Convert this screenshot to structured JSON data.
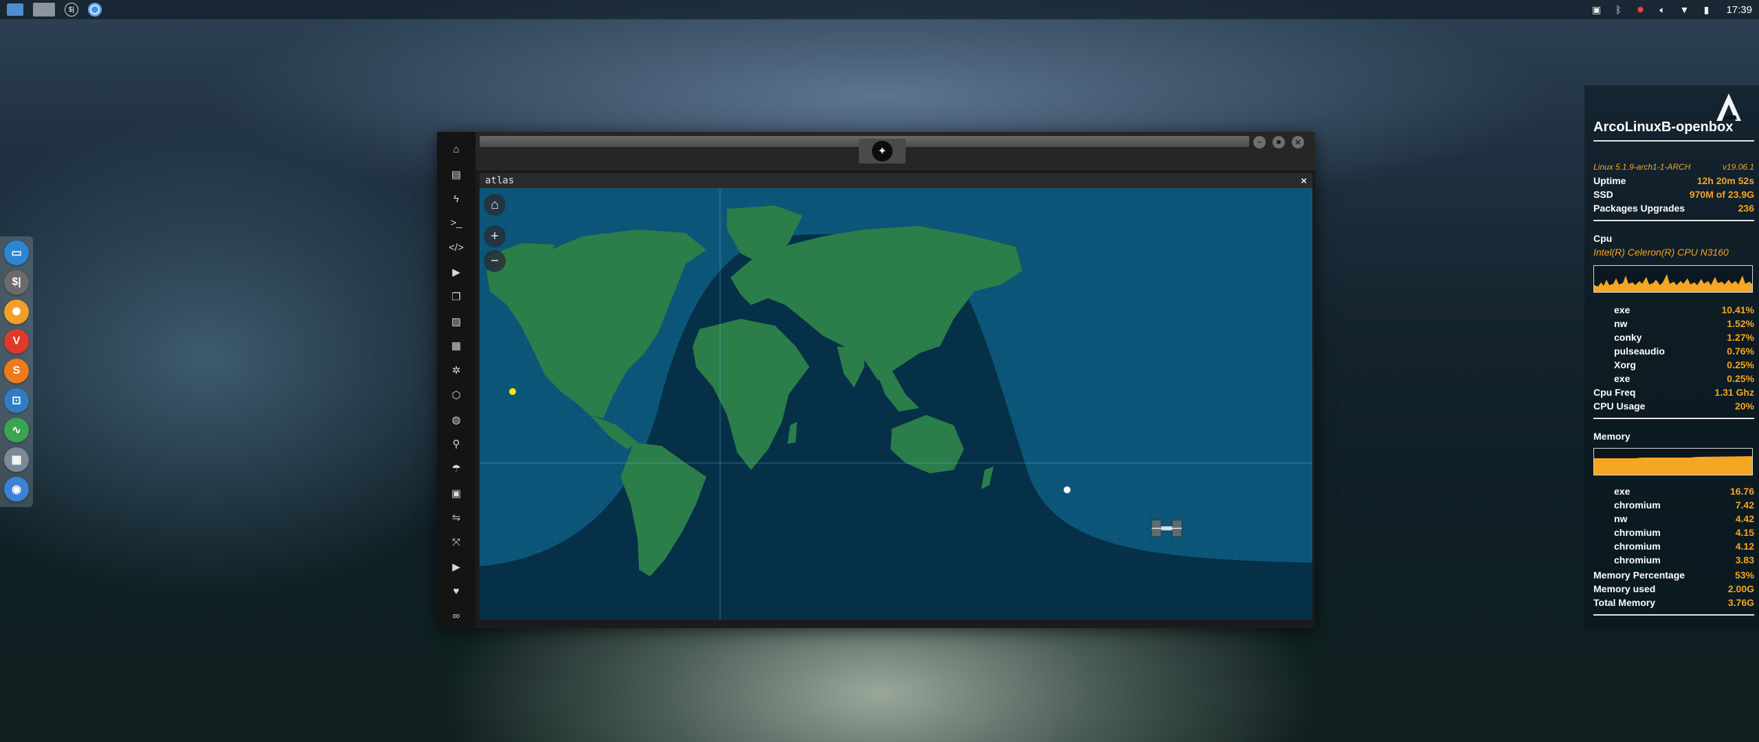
{
  "top_panel": {
    "launchers": [
      {
        "name": "files-icon"
      },
      {
        "name": "workspace-switcher-icon"
      },
      {
        "name": "terminal-icon",
        "glyph": "$|"
      },
      {
        "name": "chromium-icon"
      }
    ],
    "tray": [
      "screenshot-icon",
      "bluetooth-icon",
      "bug-icon",
      "volume-icon",
      "wifi-icon",
      "power-icon"
    ],
    "clock": "17:39"
  },
  "dock": {
    "items": [
      {
        "name": "files",
        "color": "#2d86d1",
        "glyph": "▭"
      },
      {
        "name": "terminal",
        "color": "#6b6b6b",
        "glyph": "$|"
      },
      {
        "name": "settings",
        "color": "#f0a02a",
        "glyph": "✺"
      },
      {
        "name": "vivaldi",
        "color": "#e0392a",
        "glyph": "V"
      },
      {
        "name": "sublime",
        "color": "#ee7a1e",
        "glyph": "S"
      },
      {
        "name": "screenshot",
        "color": "#2f7cc4",
        "glyph": "⊡"
      },
      {
        "name": "system-monitor",
        "color": "#3aa450",
        "glyph": "∿"
      },
      {
        "name": "workspace",
        "color": "#7b8a99",
        "glyph": "▦"
      },
      {
        "name": "chromium",
        "color": "#3d82d6",
        "glyph": "◉"
      }
    ]
  },
  "window": {
    "emblem_glyph": "✦",
    "buttons": {
      "minimize": "–",
      "maximize": "■",
      "close": "✕"
    },
    "sidebar_icons": [
      {
        "name": "home",
        "glyph": "⌂"
      },
      {
        "name": "document",
        "glyph": "▤"
      },
      {
        "name": "bolt",
        "glyph": "ϟ"
      },
      {
        "name": "terminal",
        "glyph": ">_"
      },
      {
        "name": "code",
        "glyph": "</>"
      },
      {
        "name": "play",
        "glyph": "▶"
      },
      {
        "name": "copy",
        "glyph": "❐"
      },
      {
        "name": "image",
        "glyph": "▨"
      },
      {
        "name": "news",
        "glyph": "▦"
      },
      {
        "name": "atom",
        "glyph": "✲"
      },
      {
        "name": "hexagon",
        "glyph": "⬡"
      },
      {
        "name": "globe",
        "glyph": "◍"
      },
      {
        "name": "search",
        "glyph": "⚲"
      },
      {
        "name": "umbrella",
        "glyph": "☂"
      },
      {
        "name": "contact",
        "glyph": "▣"
      },
      {
        "name": "exchange",
        "glyph": "⇋"
      },
      {
        "name": "expand",
        "glyph": "⤧"
      },
      {
        "name": "youtube",
        "glyph": "▶"
      },
      {
        "name": "heart",
        "glyph": "♥"
      },
      {
        "name": "infinity",
        "glyph": "∞"
      }
    ],
    "app_title": "atlas",
    "app_close": "×",
    "map": {
      "home_glyph": "⌂",
      "zoom_in": "+",
      "zoom_out": "−",
      "colors": {
        "ocean": "#0b5578",
        "land": "#2b7d4a",
        "night": "#052a40"
      }
    }
  },
  "conky": {
    "hostname": "ArcoLinuxB-openbox",
    "kernel": "Linux 5.1.9-arch1-1-ARCH",
    "version": "v19.06.1",
    "rows_system": [
      {
        "label": "Uptime",
        "value": "12h 20m 52s"
      },
      {
        "label": "SSD",
        "value": "970M of 23.9G"
      },
      {
        "label": "Packages Upgrades",
        "value": "236"
      }
    ],
    "cpu": {
      "heading": "Cpu",
      "model": "Intel(R) Celeron(R) CPU  N3160",
      "processes": [
        {
          "name": "exe",
          "value": "10.41%"
        },
        {
          "name": "nw",
          "value": "1.52%"
        },
        {
          "name": "conky",
          "value": "1.27%"
        },
        {
          "name": "pulseaudio",
          "value": "0.76%"
        },
        {
          "name": "Xorg",
          "value": "0.25%"
        },
        {
          "name": "exe",
          "value": "0.25%"
        }
      ],
      "freq_label": "Cpu Freq",
      "freq_value": "1.31 Ghz",
      "usage_label": "CPU Usage",
      "usage_value": "20%"
    },
    "memory": {
      "heading": "Memory",
      "processes": [
        {
          "name": "exe",
          "value": "16.76"
        },
        {
          "name": "chromium",
          "value": "7.42"
        },
        {
          "name": "nw",
          "value": "4.42"
        },
        {
          "name": "chromium",
          "value": "4.15"
        },
        {
          "name": "chromium",
          "value": "4.12"
        },
        {
          "name": "chromium",
          "value": "3.83"
        }
      ],
      "percent_label": "Memory Percentage",
      "percent_value": "53%",
      "used_label": "Memory used",
      "used_value": "2.00G",
      "total_label": "Total Memory",
      "total_value": "3.76G"
    },
    "accent": "#f5a623"
  }
}
